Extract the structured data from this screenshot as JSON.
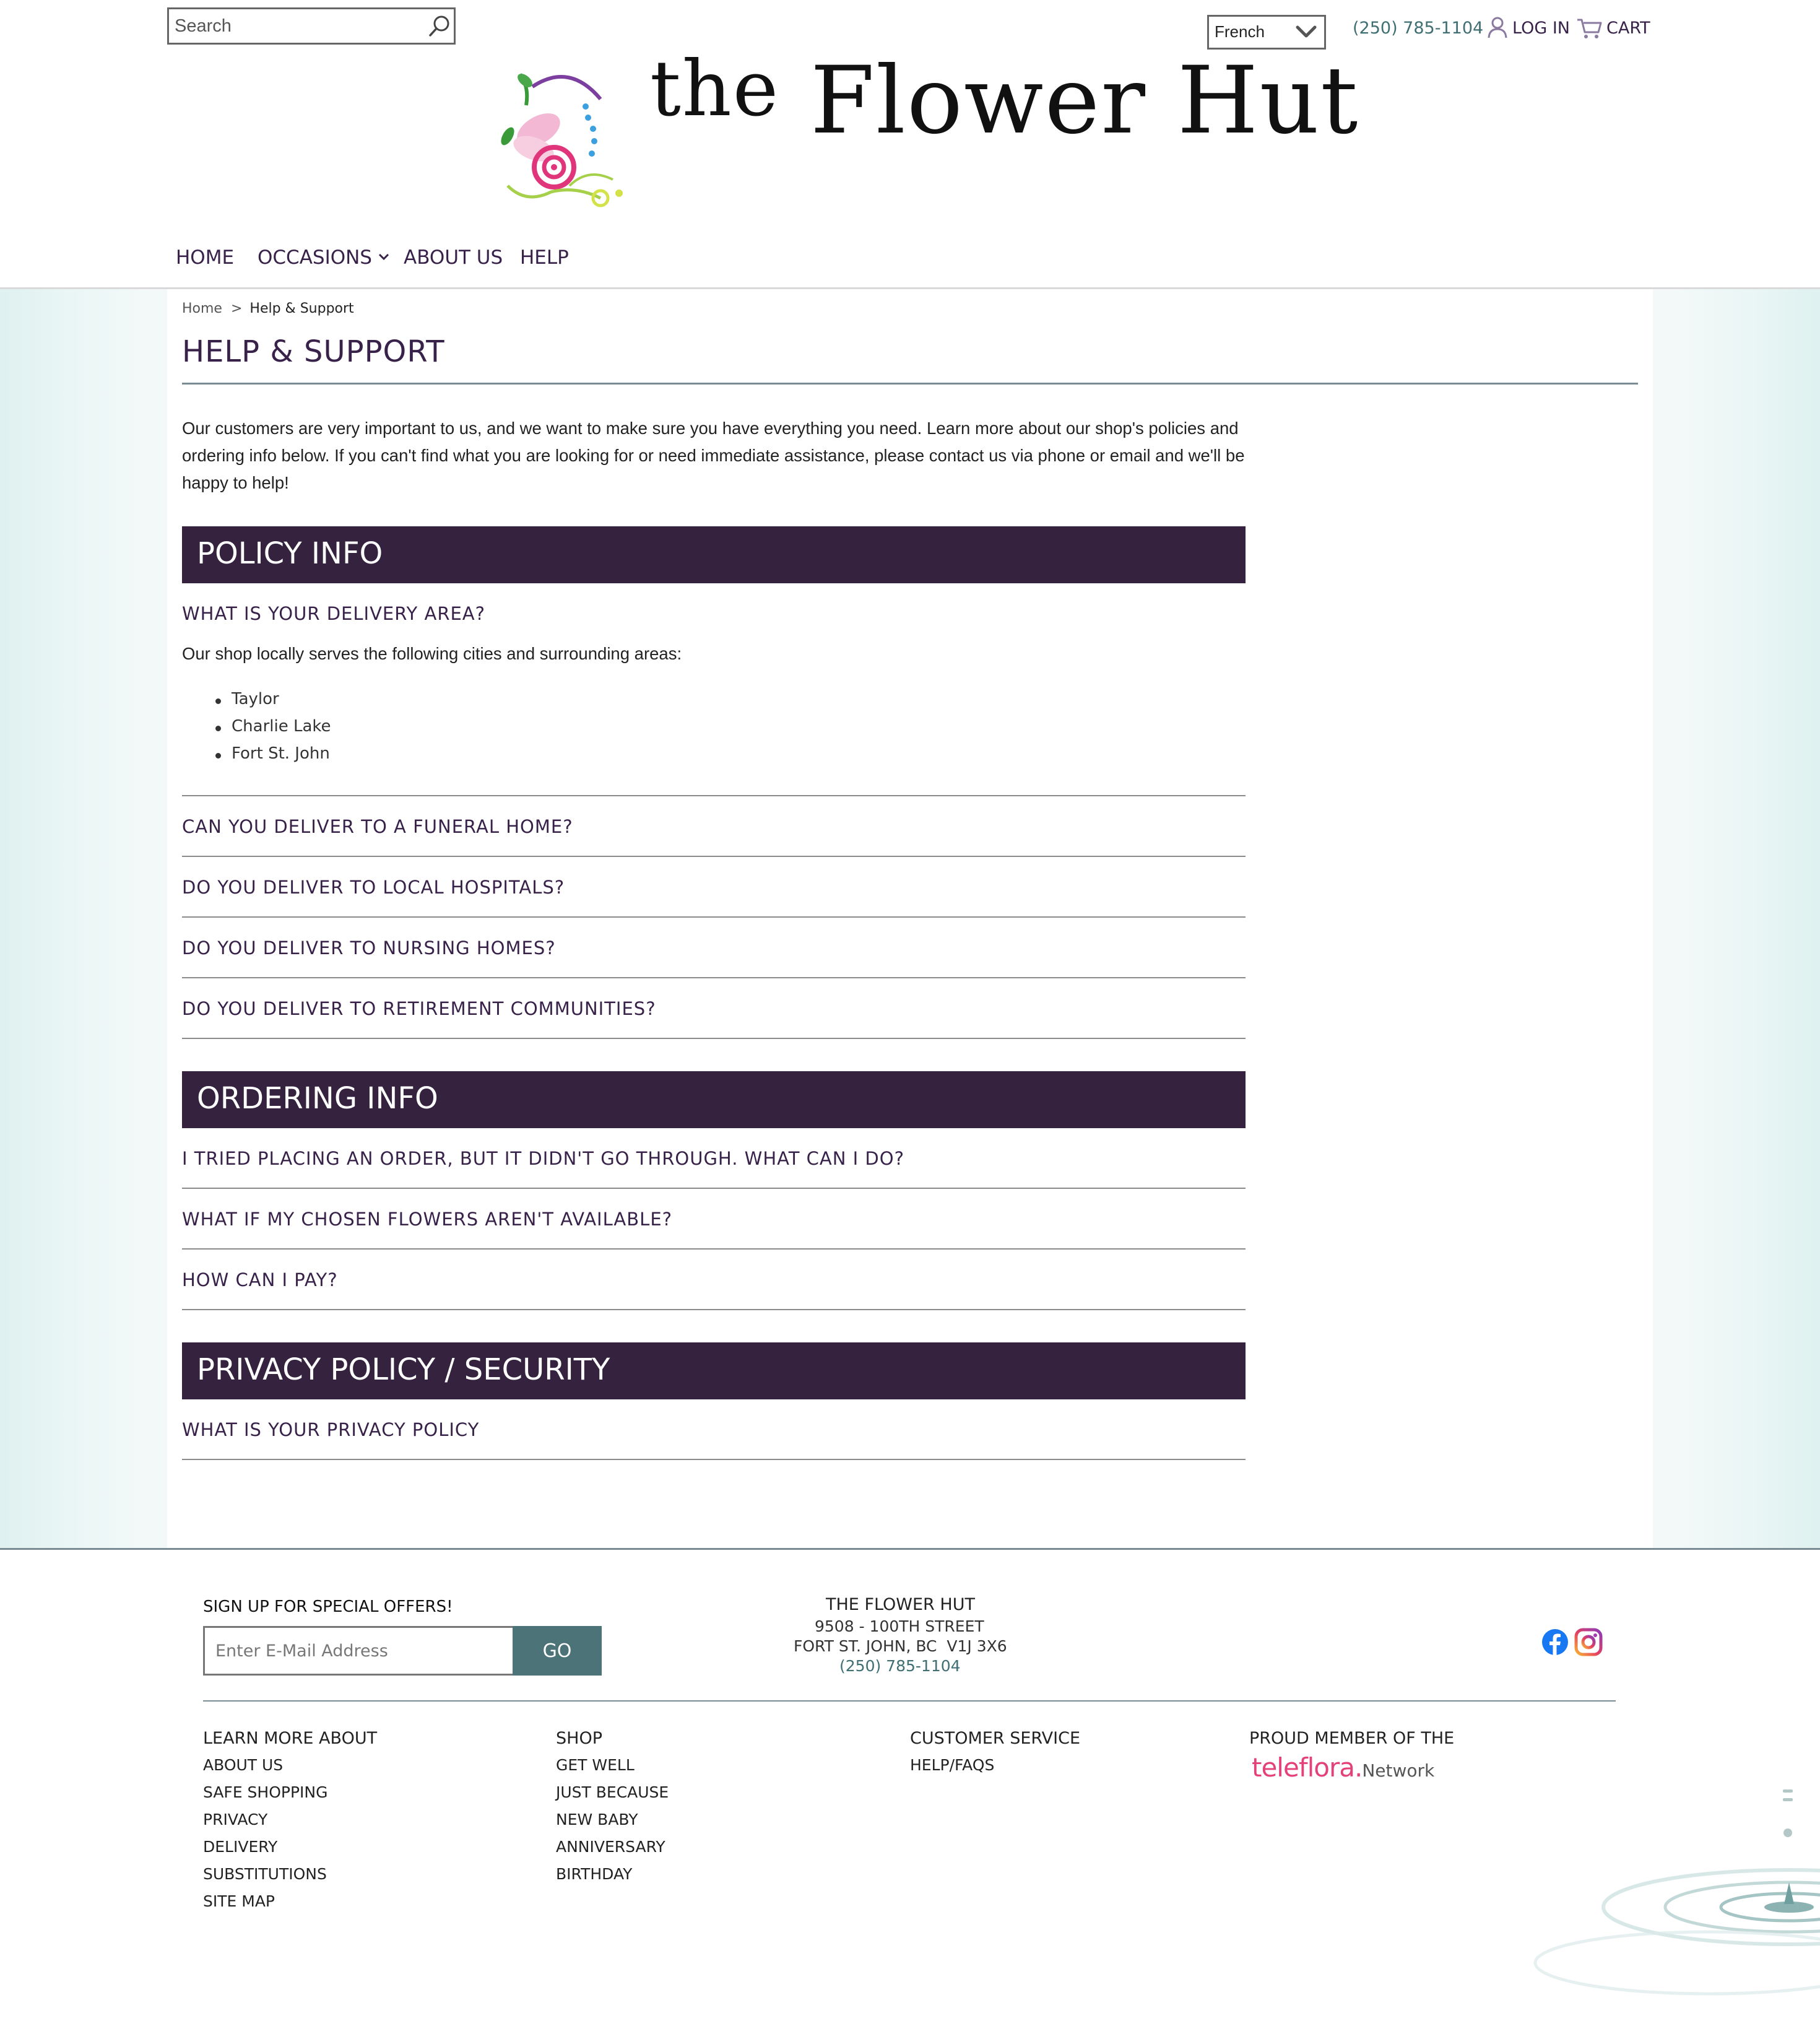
{
  "header": {
    "search_placeholder": "Search",
    "language": "French",
    "phone": "(250) 785-1104",
    "login": "LOG IN",
    "cart": "CART"
  },
  "logo": {
    "the": "the",
    "name": "Flower Hut"
  },
  "nav": {
    "home": "HOME",
    "occasions": "OCCASIONS",
    "about": "ABOUT US",
    "help": "HELP"
  },
  "breadcrumb": {
    "home": "Home",
    "sep": ">",
    "current": "Help & Support"
  },
  "page": {
    "title": "HELP & SUPPORT",
    "intro": "Our customers are very important to us, and we want to make sure you have everything you need. Learn more about our shop's policies and ordering info below. If you can't find what you are looking for or need immediate assistance, please contact us via phone or email and we'll be happy to help!"
  },
  "sections": {
    "policy": {
      "label": "POLICY INFO",
      "q1": "WHAT IS YOUR DELIVERY AREA?",
      "a1": "Our shop locally serves the following cities and surrounding areas:",
      "cities": [
        "Taylor",
        "Charlie Lake",
        "Fort St. John"
      ],
      "q2": "CAN YOU DELIVER TO A FUNERAL HOME?",
      "q3": "DO YOU DELIVER TO LOCAL HOSPITALS?",
      "q4": "DO YOU DELIVER TO NURSING HOMES?",
      "q5": "DO YOU DELIVER TO RETIREMENT COMMUNITIES?"
    },
    "ordering": {
      "label": "ORDERING INFO",
      "q1": "I TRIED PLACING AN ORDER, BUT IT DIDN'T GO THROUGH. WHAT CAN I DO?",
      "q2": "WHAT IF MY CHOSEN FLOWERS AREN'T AVAILABLE?",
      "q3": "HOW CAN I PAY?"
    },
    "privacy": {
      "label": "PRIVACY POLICY / SECURITY",
      "q1": "WHAT IS YOUR PRIVACY POLICY"
    }
  },
  "footer": {
    "signup_label": "SIGN UP FOR SPECIAL OFFERS!",
    "email_placeholder": "Enter E-Mail Address",
    "go": "GO",
    "shop_name": "THE FLOWER HUT",
    "address1": "9508 - 100TH STREET",
    "address2": "FORT ST. JOHN, BC  V1J 3X6",
    "phone": "(250) 785-1104",
    "learn_head": "LEARN MORE ABOUT",
    "learn_links": [
      "ABOUT US",
      "SAFE SHOPPING",
      "PRIVACY",
      "DELIVERY",
      "SUBSTITUTIONS",
      "SITE MAP"
    ],
    "shop_head": "SHOP",
    "shop_links": [
      "GET WELL",
      "JUST BECAUSE",
      "NEW BABY",
      "ANNIVERSARY",
      "BIRTHDAY"
    ],
    "service_head": "CUSTOMER SERVICE",
    "service_links": [
      "HELP/FAQS"
    ],
    "member_head": "PROUD MEMBER OF THE",
    "teleflora": "teleflora.",
    "network": "Network"
  },
  "colors": {
    "brand_purple": "#35223f",
    "text_purple": "#38224a",
    "teal": "#4c7377",
    "teleflora_pink": "#e4407a"
  }
}
